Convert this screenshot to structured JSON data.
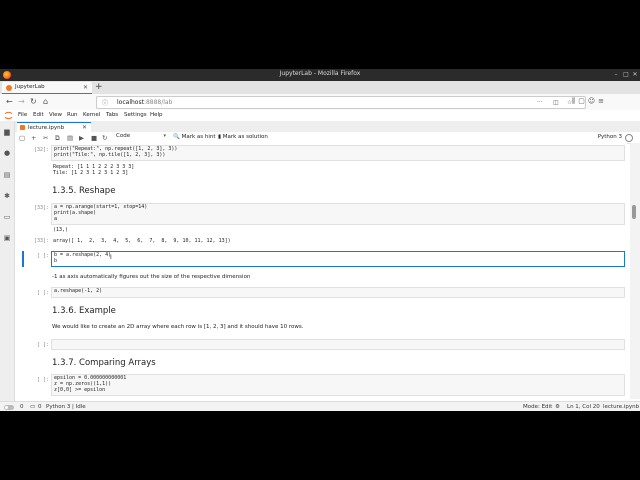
{
  "window": {
    "title": "JupyterLab - Mozilla Firefox",
    "controls": [
      "–",
      "□",
      "✕"
    ]
  },
  "browser": {
    "tab_title": "JupyterLab",
    "url_host": "localhost",
    "url_rest": ":8888/lab"
  },
  "menu": [
    "File",
    "Edit",
    "View",
    "Run",
    "Kernel",
    "Tabs",
    "Settings",
    "Help"
  ],
  "doc_tab": {
    "name": "lecture.ipynb"
  },
  "toolbar": {
    "cell_type": "Code",
    "mark_hint": "Mark as hint",
    "mark_solution": "Mark as solution",
    "kernel": "Python 3"
  },
  "cells": {
    "c1": {
      "prompt": "[32]:",
      "lines": [
        "print(\"Repeat:\", np.repeat([1, 2, 3], 3))",
        "print(\"Tile:\", np.tile([1, 2, 3], 3))"
      ],
      "output": [
        "Repeat: [1 1 1 2 2 2 3 3 3]",
        "Tile: [1 2 3 1 2 3 1 2 3]"
      ]
    },
    "h1": "1.3.5. Reshape",
    "c2": {
      "prompt": "[33]:",
      "lines": [
        "a = np.arange(start=1, stop=14)",
        "print(a.shape)",
        "a"
      ],
      "out_prompt": "[33]:",
      "output": [
        "(13,)",
        "array([ 1,  2,  3,  4,  5,  6,  7,  8,  9, 10, 11, 12, 13])"
      ]
    },
    "c3": {
      "prompt": "[ ]:",
      "lines": [
        "b = a.reshape(2, 4)",
        "b"
      ]
    },
    "m1": "-1 as axis automatically figures out the size of the respective dimension",
    "c4": {
      "prompt": "[ ]:",
      "lines": [
        "a.reshape(-1, 2)"
      ]
    },
    "h2": "1.3.6. Example",
    "m2": "We would like to create an 2D array where each row is [1, 2, 3] and it should have 10 rows.",
    "c5": {
      "prompt": "[ ]:",
      "lines": [
        ""
      ]
    },
    "h3": "1.3.7. Comparing Arrays",
    "c6": {
      "prompt": "[ ]:",
      "lines": [
        "epsilon = 0.000000000001",
        "z = np.zeros((1,1))",
        "z[0,0] >= epsilon"
      ]
    }
  },
  "status": {
    "left_count": "0",
    "kernel_info": "Python 3 | Idle",
    "mode": "Mode: Edit",
    "position": "Ln 1, Col 20",
    "file": "lecture.ipynb"
  }
}
